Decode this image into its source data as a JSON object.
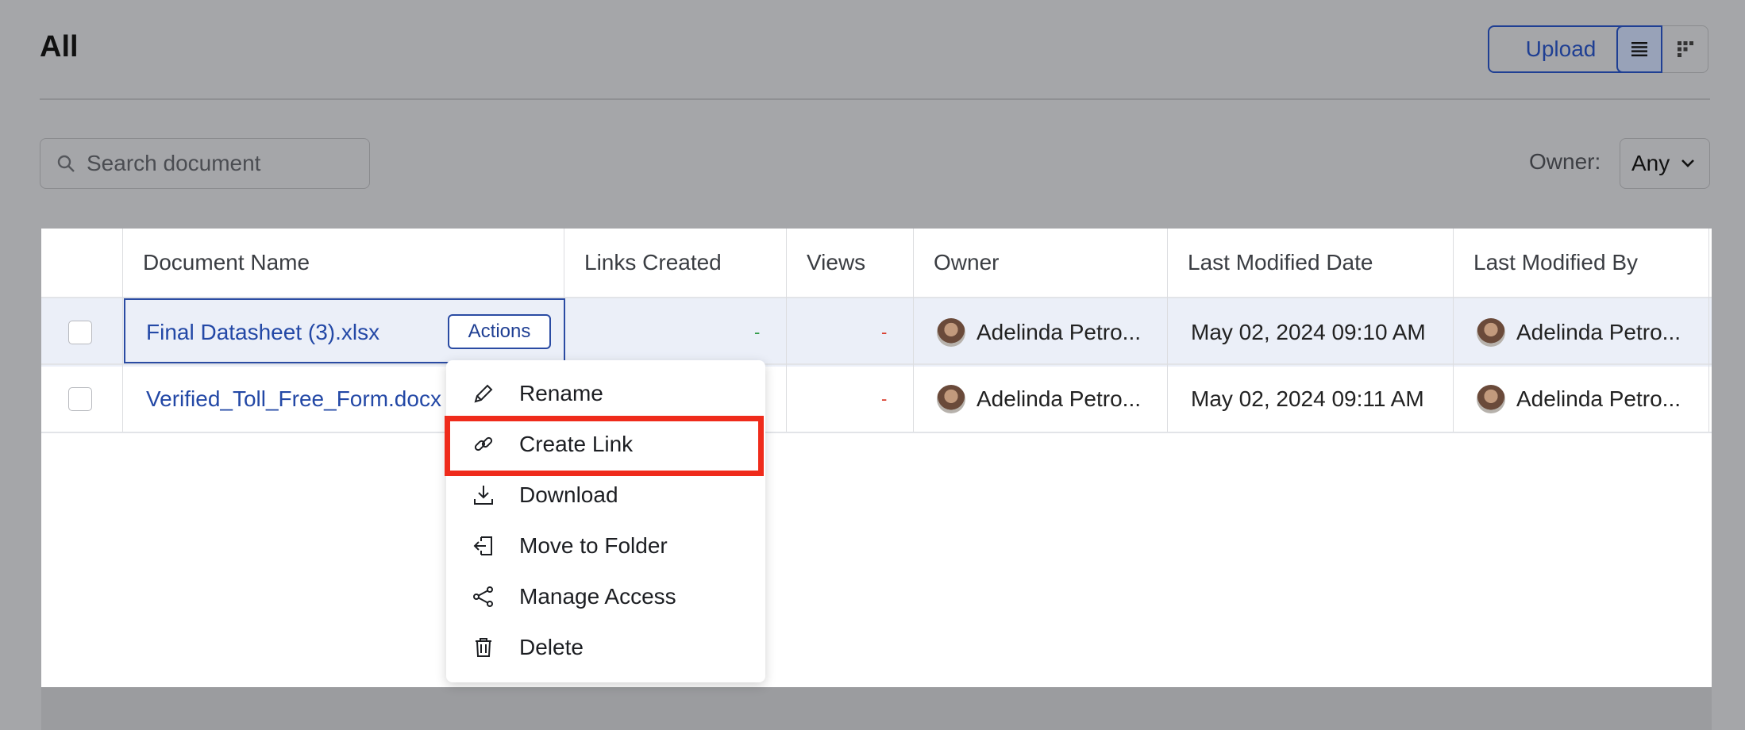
{
  "page": {
    "title": "All"
  },
  "toolbar": {
    "upload_label": "Upload",
    "view_list_icon": "list-view-icon",
    "view_grid_icon": "grid-view-icon"
  },
  "search": {
    "placeholder": "Search document"
  },
  "filter": {
    "owner_label": "Owner:",
    "owner_value": "Any"
  },
  "table": {
    "headers": [
      "Document Name",
      "Links Created",
      "Views",
      "Owner",
      "Last Modified Date",
      "Last Modified By"
    ],
    "rows": [
      {
        "name": "Final Datasheet (3).xlsx",
        "links": "-",
        "views": "-",
        "owner": "Adelinda Petro...",
        "modified_date": "May 02, 2024 09:10 AM",
        "modified_by": "Adelinda Petro..."
      },
      {
        "name": "Verified_Toll_Free_Form.docx",
        "links": "",
        "views": "-",
        "owner": "Adelinda Petro...",
        "modified_date": "May 02, 2024 09:11 AM",
        "modified_by": "Adelinda Petro..."
      }
    ],
    "actions_label": "Actions"
  },
  "menu": {
    "items": [
      {
        "label": "Rename",
        "icon": "pencil-icon"
      },
      {
        "label": "Create Link",
        "icon": "link-icon"
      },
      {
        "label": "Download",
        "icon": "download-icon"
      },
      {
        "label": "Move to Folder",
        "icon": "move-folder-icon"
      },
      {
        "label": "Manage Access",
        "icon": "share-icon"
      },
      {
        "label": "Delete",
        "icon": "trash-icon"
      }
    ]
  },
  "colors": {
    "highlight": "#ef2b1b",
    "accent": "#1f3f93",
    "link": "#2348a6"
  }
}
